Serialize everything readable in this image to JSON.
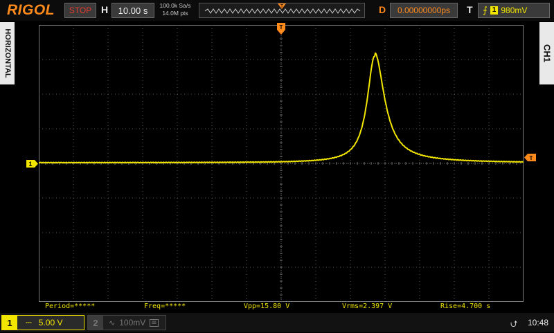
{
  "brand": "RIGOL",
  "run_status": "STOP",
  "horizontal": {
    "label": "H",
    "timebase": "10.00 s"
  },
  "acquisition": {
    "sample_rate": "100.0k Sa/s",
    "memory_depth": "14.0M pts"
  },
  "delay": {
    "label": "D",
    "value": "0.00000000ps"
  },
  "trigger": {
    "label": "T",
    "source": "1",
    "level": "980mV",
    "marker": "T"
  },
  "side_tabs": {
    "left": "HORIZONTAL",
    "right": "CH1"
  },
  "channel_marker": "1",
  "measurements": [
    {
      "text": "Period=*****"
    },
    {
      "text": "Freq=*****"
    },
    {
      "text": "Vpp=15.80 V"
    },
    {
      "text": "Vrms=2.397 V"
    },
    {
      "text": "Rise=4.700 s"
    }
  ],
  "channels": {
    "ch1": {
      "number": "1",
      "scale": "5.00 V",
      "coupling": "DC",
      "color": "#f2e600"
    },
    "ch2": {
      "number": "2",
      "scale": "100mV",
      "coupling": "AC",
      "color": "#777777"
    }
  },
  "clock": "10:48",
  "icons": {
    "usb": "usb-icon",
    "trigger_edge": "rising-edge-icon",
    "bw_limit": "bw-limit-icon"
  },
  "colors": {
    "trace": "#f2e600",
    "accent": "#ff8a1c",
    "grid": "#5a5a5a",
    "stop": "#e23b2e"
  }
}
